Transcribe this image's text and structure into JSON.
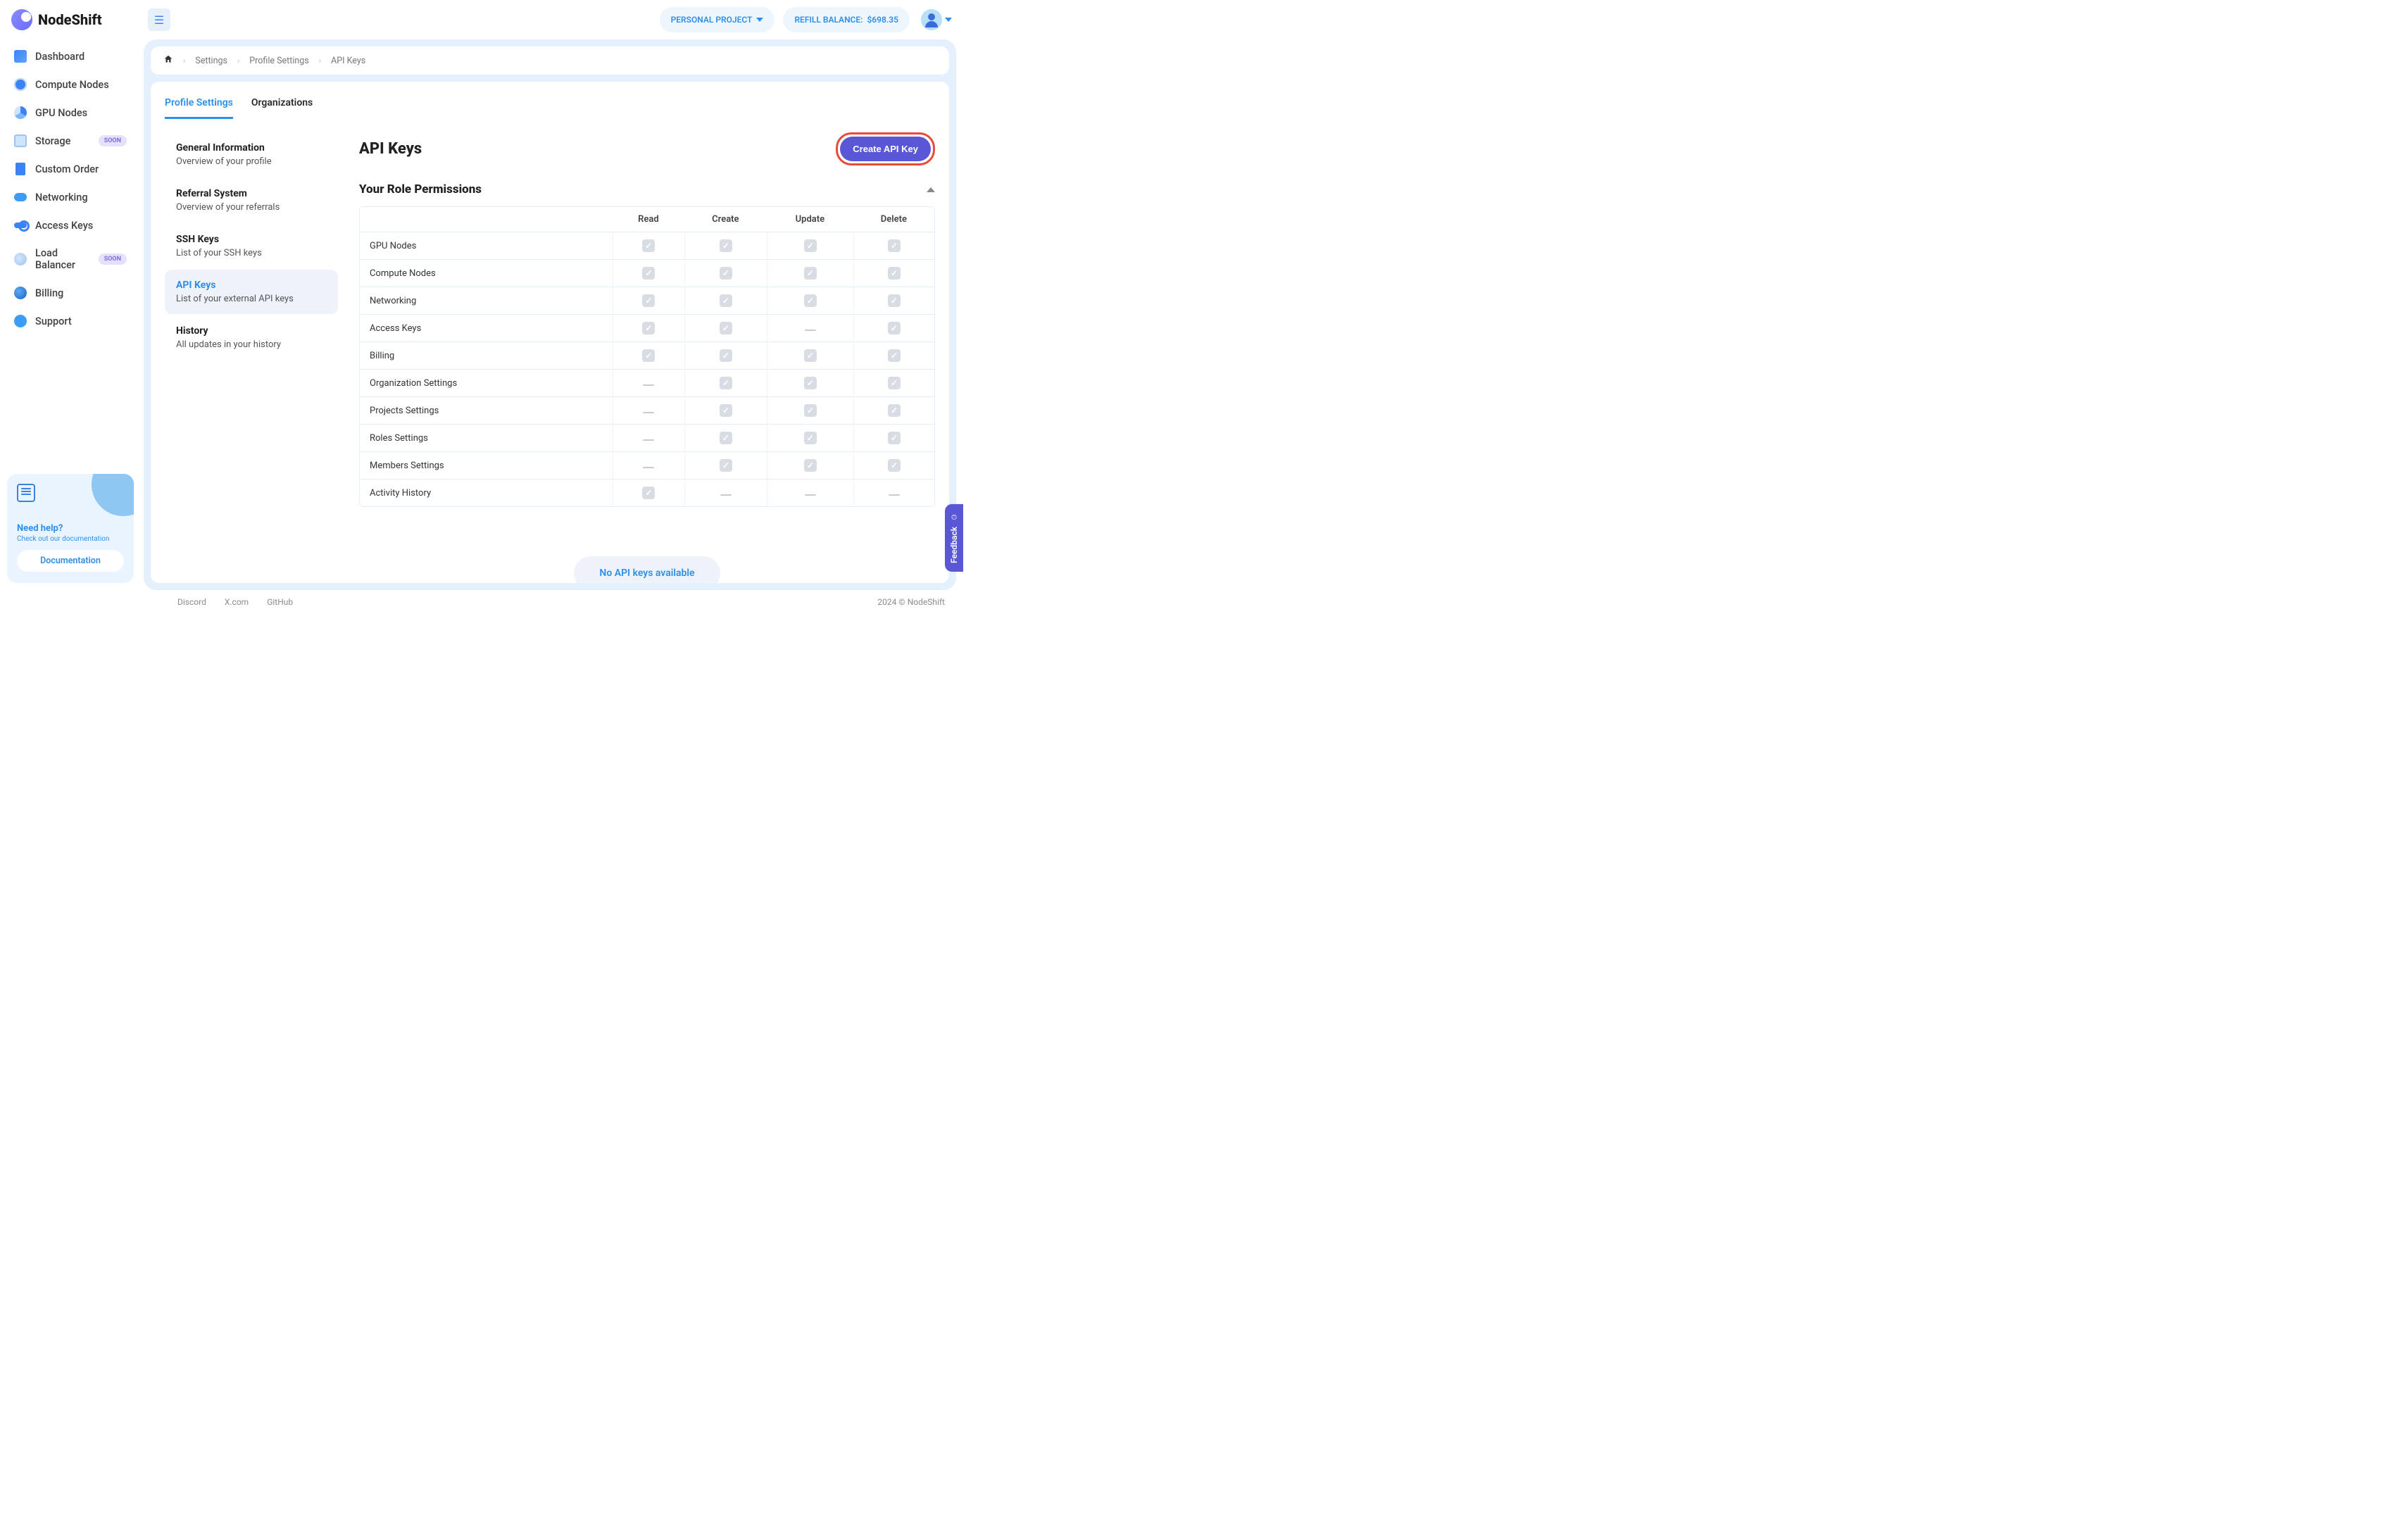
{
  "brand": {
    "name": "NodeShift"
  },
  "topbar": {
    "project_label": "PERSONAL PROJECT",
    "refill_label": "REFILL BALANCE:",
    "balance": "$698.35"
  },
  "sidebar": {
    "items": [
      {
        "label": "Dashboard",
        "icon": "ic-dash"
      },
      {
        "label": "Compute Nodes",
        "icon": "ic-comp"
      },
      {
        "label": "GPU Nodes",
        "icon": "ic-gpu"
      },
      {
        "label": "Storage",
        "icon": "ic-stor",
        "badge": "SOON"
      },
      {
        "label": "Custom Order",
        "icon": "ic-cust"
      },
      {
        "label": "Networking",
        "icon": "ic-net"
      },
      {
        "label": "Access Keys",
        "icon": "ic-key"
      },
      {
        "label": "Load Balancer",
        "icon": "ic-lb",
        "badge": "SOON"
      },
      {
        "label": "Billing",
        "icon": "ic-bill"
      },
      {
        "label": "Support",
        "icon": "ic-sup"
      }
    ],
    "help": {
      "title": "Need help?",
      "subtitle": "Check out our documentation",
      "button": "Documentation"
    }
  },
  "breadcrumb": [
    "Settings",
    "Profile Settings",
    "API Keys"
  ],
  "tabs": {
    "profile": "Profile Settings",
    "orgs": "Organizations"
  },
  "settings_nav": [
    {
      "title": "General Information",
      "sub": "Overview of your profile"
    },
    {
      "title": "Referral System",
      "sub": "Overview of your referrals"
    },
    {
      "title": "SSH Keys",
      "sub": "List of your SSH keys"
    },
    {
      "title": "API Keys",
      "sub": "List of your external API keys",
      "active": true
    },
    {
      "title": "History",
      "sub": "All updates in your history"
    }
  ],
  "page": {
    "title": "API Keys",
    "create_button": "Create API Key",
    "section": "Your Role Permissions",
    "empty": "No API keys available"
  },
  "perm_columns": [
    "Read",
    "Create",
    "Update",
    "Delete"
  ],
  "perm_rows": [
    {
      "name": "GPU Nodes",
      "cells": [
        "check",
        "check",
        "check",
        "check"
      ]
    },
    {
      "name": "Compute Nodes",
      "cells": [
        "check",
        "check",
        "check",
        "check"
      ]
    },
    {
      "name": "Networking",
      "cells": [
        "check",
        "check",
        "check",
        "check"
      ]
    },
    {
      "name": "Access Keys",
      "cells": [
        "check",
        "check",
        "dash",
        "check"
      ]
    },
    {
      "name": "Billing",
      "cells": [
        "check",
        "check",
        "check",
        "check"
      ]
    },
    {
      "name": "Organization Settings",
      "cells": [
        "dash",
        "check",
        "check",
        "check"
      ]
    },
    {
      "name": "Projects Settings",
      "cells": [
        "dash",
        "check",
        "check",
        "check"
      ]
    },
    {
      "name": "Roles Settings",
      "cells": [
        "dash",
        "check",
        "check",
        "check"
      ]
    },
    {
      "name": "Members Settings",
      "cells": [
        "dash",
        "check",
        "check",
        "check"
      ]
    },
    {
      "name": "Activity History",
      "cells": [
        "check",
        "dash",
        "dash",
        "dash"
      ]
    }
  ],
  "footer": {
    "links": [
      "Discord",
      "X.com",
      "GitHub"
    ],
    "copyright": "2024 © NodeShift"
  },
  "feedback": "Feedback"
}
